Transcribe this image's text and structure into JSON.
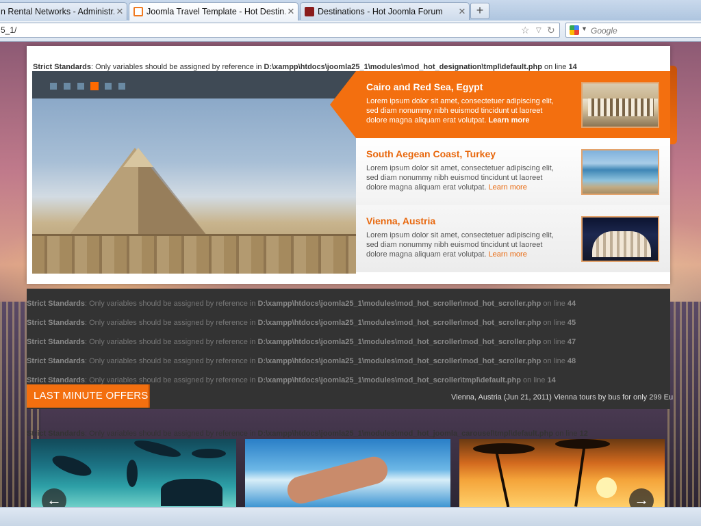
{
  "browser": {
    "tabs": [
      {
        "title": "n Rental Networks - Administr...",
        "active": false,
        "favicon": "joomla-admin-icon"
      },
      {
        "title": "Joomla Travel Template - Hot Destin...",
        "active": true,
        "favicon": "xampp-icon"
      },
      {
        "title": "Destinations - Hot Joomla Forum",
        "active": false,
        "favicon": "forum-icon"
      }
    ],
    "new_tab_symbol": "+",
    "url": "5_1/",
    "search_placeholder": "Google"
  },
  "notices": {
    "designation": {
      "label": "Strict Standards",
      "text": ": Only variables should be assigned by reference in ",
      "path": "D:\\xampp\\htdocs\\joomla25_1\\modules\\mod_hot_designation\\tmpl\\default.php",
      "online": " on line ",
      "line": "14"
    },
    "scroller": [
      {
        "label": "Strict Standards",
        "text": ": Only variables should be assigned by reference in ",
        "path": "D:\\xampp\\htdocs\\joomla25_1\\modules\\mod_hot_scroller\\mod_hot_scroller.php",
        "online": " on line ",
        "line": "44"
      },
      {
        "label": "Strict Standards",
        "text": ": Only variables should be assigned by reference in ",
        "path": "D:\\xampp\\htdocs\\joomla25_1\\modules\\mod_hot_scroller\\mod_hot_scroller.php",
        "online": " on line ",
        "line": "45"
      },
      {
        "label": "Strict Standards",
        "text": ": Only variables should be assigned by reference in ",
        "path": "D:\\xampp\\htdocs\\joomla25_1\\modules\\mod_hot_scroller\\mod_hot_scroller.php",
        "online": " on line ",
        "line": "47"
      },
      {
        "label": "Strict Standards",
        "text": ": Only variables should be assigned by reference in ",
        "path": "D:\\xampp\\htdocs\\joomla25_1\\modules\\mod_hot_scroller\\mod_hot_scroller.php",
        "online": " on line ",
        "line": "48"
      },
      {
        "label": "Strict Standards",
        "text": ": Only variables should be assigned by reference in ",
        "path": "D:\\xampp\\htdocs\\joomla25_1\\modules\\mod_hot_scroller\\tmpl\\default.php",
        "online": " on line ",
        "line": "14"
      }
    ],
    "carousel": {
      "label": "Strict Standards",
      "text": ": Only variables should be assigned by reference in ",
      "path": "D:\\xampp\\htdocs\\joomla25_1\\modules\\mod_hot_joomla_carousel\\tmpl\\default.php",
      "online": " on line ",
      "line": "12"
    }
  },
  "slider": {
    "dots": 6,
    "active_dot": 4,
    "items": [
      {
        "title": "Cairo and Red Sea, Egypt",
        "text": "Lorem ipsum dolor sit amet, consectetuer adipiscing elit, sed diam nonummy nibh euismod tincidunt ut laoreet dolore magna aliquam erat volutpat. ",
        "link": "Learn more"
      },
      {
        "title": "South Aegean Coast, Turkey",
        "text": "Lorem ipsum dolor sit amet, consectetuer adipiscing elit, sed diam nonummy nibh euismod tincidunt ut laoreet dolore magna aliquam erat volutpat. ",
        "link": "Learn more"
      },
      {
        "title": "Vienna, Austria",
        "text": "Lorem ipsum dolor sit amet, consectetuer adipiscing elit, sed diam nonummy nibh euismod tincidunt ut laoreet dolore magna aliquam erat volutpat. ",
        "link": "Learn more"
      }
    ]
  },
  "offers": {
    "button": "LAST MINUTE OFFERS",
    "ticker": "Vienna, Austria (Jun 21, 2011) Vienna tours by bus for only 299 Eu"
  },
  "carousel": {
    "prev": "←",
    "next": "→"
  },
  "colors": {
    "accent": "#f36f0f",
    "dark_band": "#333333"
  }
}
